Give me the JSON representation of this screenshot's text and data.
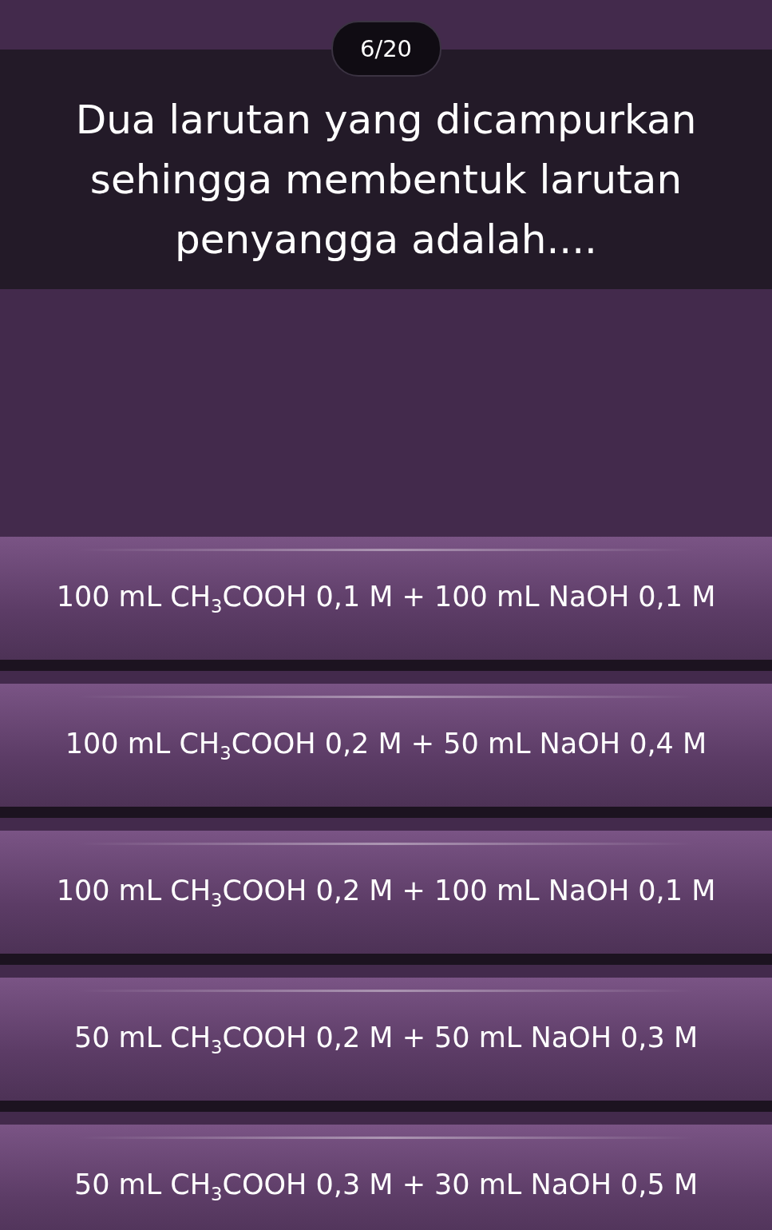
{
  "question_counter": "6/20",
  "question": "Dua larutan yang dicampurkan sehingga membentuk larutan penyangga adalah....",
  "options": [
    {
      "text": "100 mL CH$_{3}$COOH 0,1 M + 100 mL NaOH 0,1 M",
      "selected": false
    },
    {
      "text": "100 mL CH$_{3}$COOH 0,2 M + 50 mL NaOH 0,4 M",
      "selected": false
    },
    {
      "text": "100 mL CH$_{3}$COOH 0,2 M + 100 mL NaOH 0,1 M",
      "selected": false
    },
    {
      "text": "50 mL CH$_{3}$COOH 0,2 M + 50 mL NaOH 0,3 M",
      "selected": false
    },
    {
      "text": "50 mL CH$_{3}$COOH 0,3 M + 30 mL NaOH 0,5 M",
      "selected": false
    }
  ]
}
